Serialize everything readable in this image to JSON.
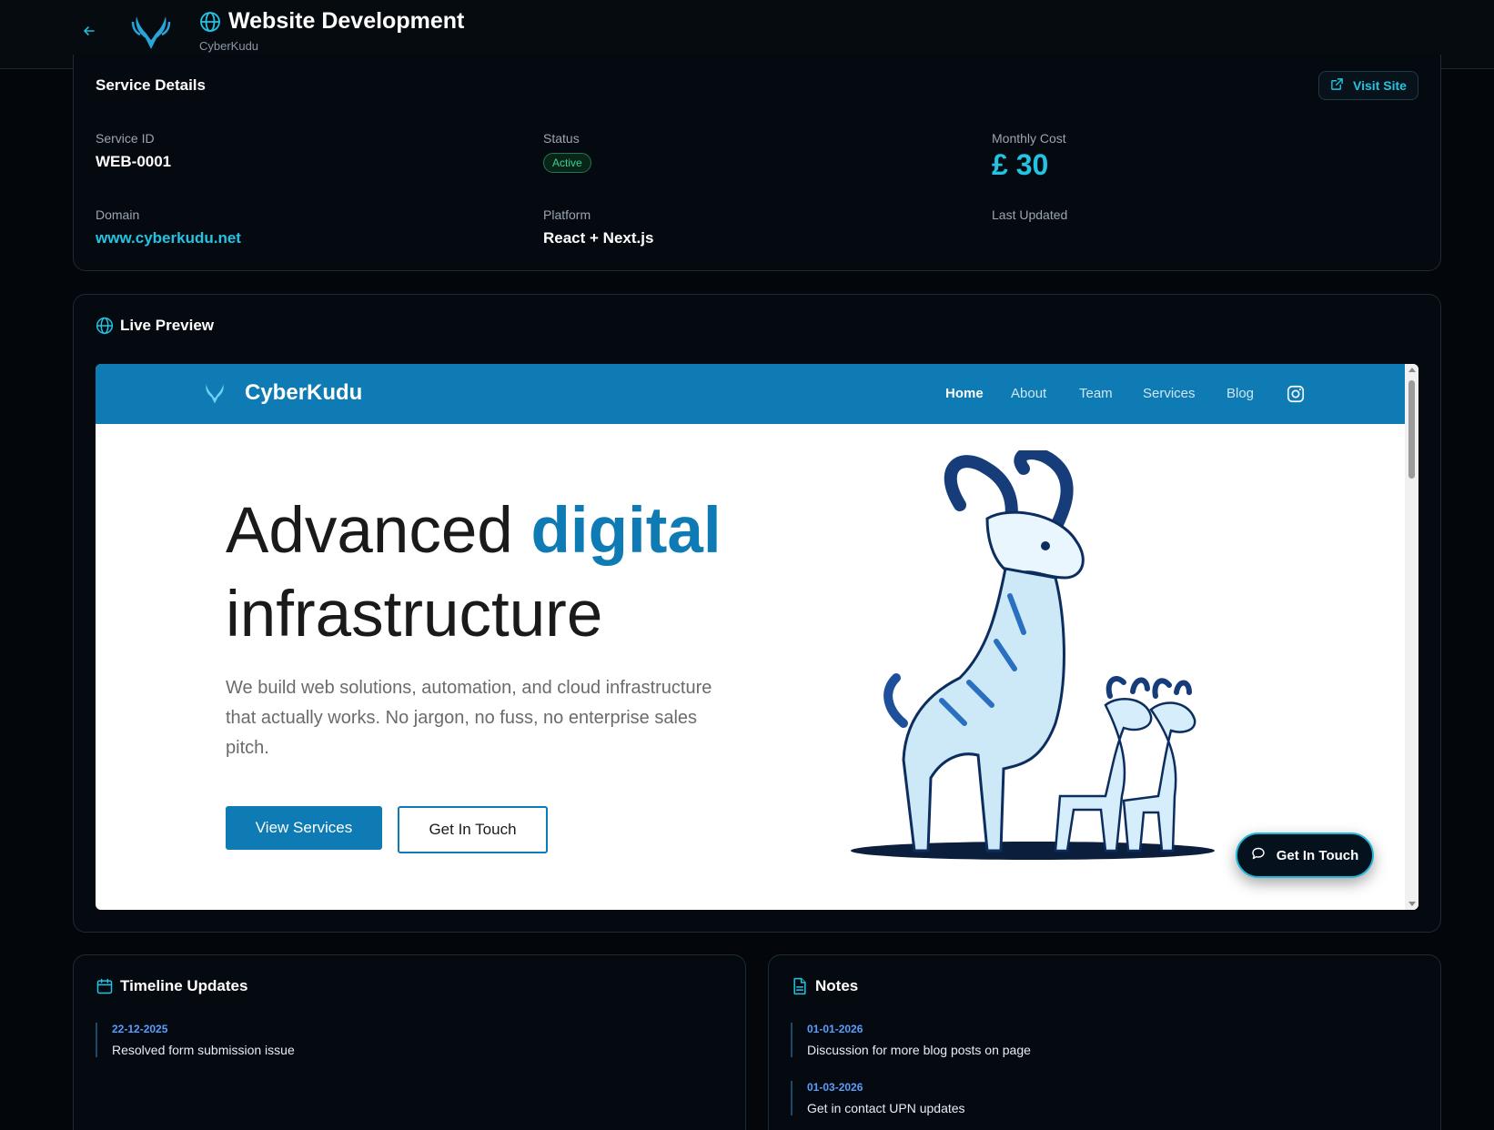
{
  "header": {
    "title": "Website Development",
    "subtitle": "CyberKudu"
  },
  "details": {
    "section_title": "Service Details",
    "visit_label": "Visit Site",
    "service_id_label": "Service ID",
    "service_id": "WEB-0001",
    "status_label": "Status",
    "status": "Active",
    "cost_label": "Monthly Cost",
    "cost": "£ 30",
    "domain_label": "Domain",
    "domain": "www.cyberkudu.net",
    "platform_label": "Platform",
    "platform": "React + Next.js",
    "updated_label": "Last Updated"
  },
  "preview": {
    "section_title": "Live Preview",
    "site": {
      "name": "CyberKudu",
      "nav": [
        "Home",
        "About",
        "Team",
        "Services",
        "Blog"
      ],
      "hero_title_plain": "Advanced ",
      "hero_title_accent": "digital",
      "hero_title_end": "infrastructure",
      "hero_description": "We build web solutions, automation, and cloud infrastructure that actually works. No jargon, no fuss, no enterprise sales pitch.",
      "primary_button": "View Services",
      "secondary_button": "Get In Touch",
      "floating_button": "Get In Touch"
    }
  },
  "timeline": {
    "section_title": "Timeline Updates",
    "entries": [
      {
        "date": "22-12-2025",
        "text": "Resolved form submission issue"
      }
    ]
  },
  "notes": {
    "section_title": "Notes",
    "entries": [
      {
        "date": "01-01-2026",
        "text": "Discussion for more blog posts on page"
      },
      {
        "date": "01-03-2026",
        "text": "Get in contact UPN updates"
      }
    ]
  },
  "colors": {
    "accent": "#22c3e3",
    "site_brand": "#0f7bb4",
    "status_active": "#34d399",
    "background": "#03070b"
  }
}
